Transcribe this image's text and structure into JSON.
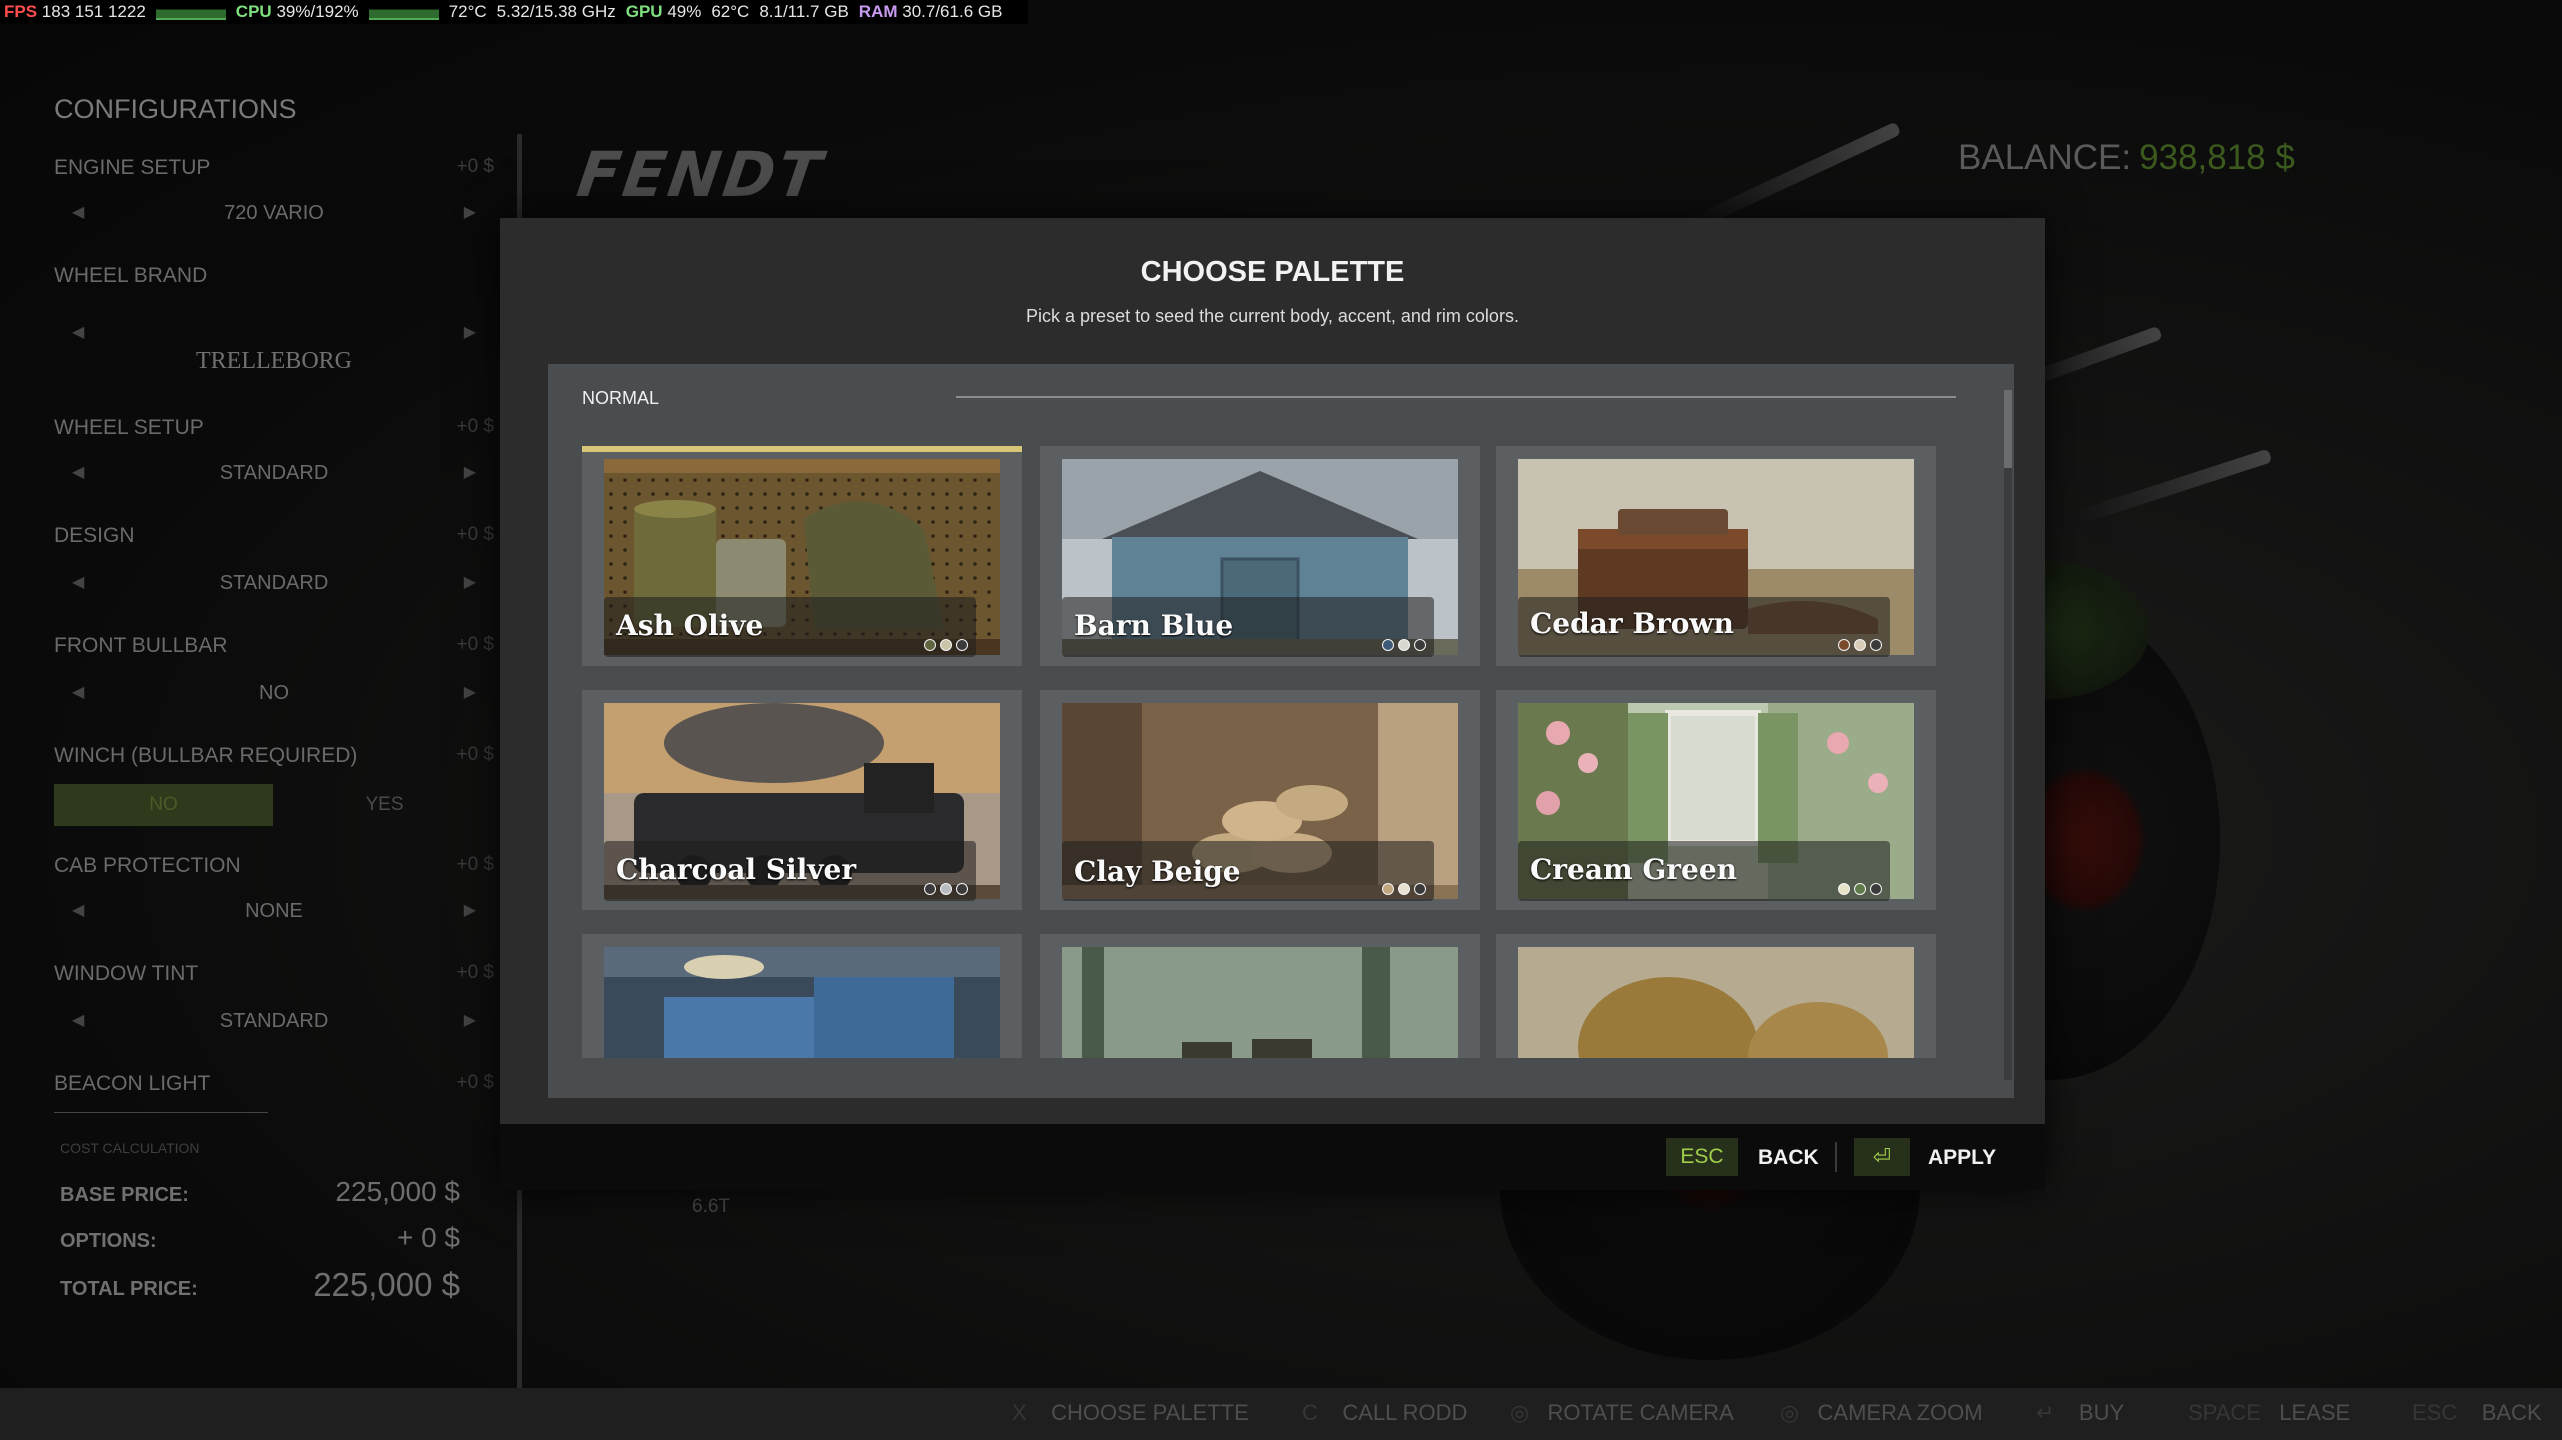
{
  "hud": {
    "fps_label": "FPS",
    "fps_values": "183 151 1222",
    "cpu_label": "CPU",
    "cpu_value": "39%/192%",
    "cpu_temp": "72°C",
    "cpu_clock": "5.32/15.38 GHz",
    "gpu_label": "GPU",
    "gpu_value": "49%",
    "gpu_temp": "62°C",
    "gpu_mem": "8.1/11.7 GB",
    "ram_label": "RAM",
    "ram_value": "30.7/61.6 GB"
  },
  "left_panel": {
    "title": "CONFIGURATIONS",
    "sections": [
      {
        "label": "ENGINE SETUP",
        "cost": "+0 $",
        "value": "720 VARIO"
      },
      {
        "label": "WHEEL BRAND",
        "cost": "",
        "value": "TRELLEBORG"
      },
      {
        "label": "WHEEL SETUP",
        "cost": "+0 $",
        "value": "STANDARD"
      },
      {
        "label": "DESIGN",
        "cost": "+0 $",
        "value": "STANDARD"
      },
      {
        "label": "FRONT BULLBAR",
        "cost": "+0 $",
        "value": "NO"
      },
      {
        "label": "WINCH (BULLBAR REQUIRED)",
        "cost": "+0 $",
        "value": ""
      },
      {
        "label": "CAB PROTECTION",
        "cost": "+0 $",
        "value": "NONE"
      },
      {
        "label": "WINDOW TINT",
        "cost": "+0 $",
        "value": "STANDARD"
      },
      {
        "label": "BEACON LIGHT",
        "cost": "+0 $",
        "value": ""
      }
    ],
    "winch_no": "NO",
    "winch_yes": "YES",
    "cost_calculation": "COST CALCULATION",
    "base_price_label": "BASE PRICE:",
    "base_price": "225,000 $",
    "options_label": "OPTIONS:",
    "options_price": "+ 0 $",
    "total_label": "TOTAL PRICE:",
    "total_price": "225,000 $"
  },
  "brand": "FENDT",
  "balance_label": "BALANCE:",
  "balance_value": "938,818 $",
  "background_label": "6.6T",
  "modal": {
    "title": "CHOOSE PALETTE",
    "subtitle": "Pick a preset to seed the current body, accent, and rim colors.",
    "category": "NORMAL",
    "palettes": [
      {
        "name": "Ash Olive",
        "dots": [
          "#5f6540",
          "#c9c4a8",
          "#3a3a3a"
        ],
        "selected": true
      },
      {
        "name": "Barn Blue",
        "dots": [
          "#3e5a78",
          "#d8d8d0",
          "#3a3a3a"
        ],
        "selected": false
      },
      {
        "name": "Cedar Brown",
        "dots": [
          "#7a4a2a",
          "#d8ccb8",
          "#3a3a3a"
        ],
        "selected": false
      },
      {
        "name": "Charcoal Silver",
        "dots": [
          "#3a3a3c",
          "#b8bcc0",
          "#3a3a3a"
        ],
        "selected": false
      },
      {
        "name": "Clay Beige",
        "dots": [
          "#c2a67e",
          "#e8e0d0",
          "#3a3a3a"
        ],
        "selected": false
      },
      {
        "name": "Cream Green",
        "dots": [
          "#e6e2c8",
          "#5e7a4a",
          "#3a3a3a"
        ],
        "selected": false
      },
      {
        "name": "",
        "dots": [],
        "selected": false
      },
      {
        "name": "",
        "dots": [],
        "selected": false
      },
      {
        "name": "",
        "dots": [],
        "selected": false
      }
    ],
    "footer": {
      "esc_key": "ESC",
      "back_label": "BACK",
      "apply_label": "APPLY"
    }
  },
  "bottom_bar": [
    {
      "key": "X",
      "label": "CHOOSE PALETTE"
    },
    {
      "key": "C",
      "label": "CALL RODD"
    },
    {
      "key": "mouse",
      "label": "ROTATE CAMERA"
    },
    {
      "key": "mouse",
      "label": "CAMERA ZOOM"
    },
    {
      "key": "↵",
      "label": "BUY"
    },
    {
      "key": "SPACE",
      "label": "LEASE"
    },
    {
      "key": "ESC",
      "label": "BACK"
    }
  ],
  "colors": {
    "accent": "#d8c678",
    "key_green": "#9fcf4a",
    "balance_green": "#3c5a1e"
  }
}
